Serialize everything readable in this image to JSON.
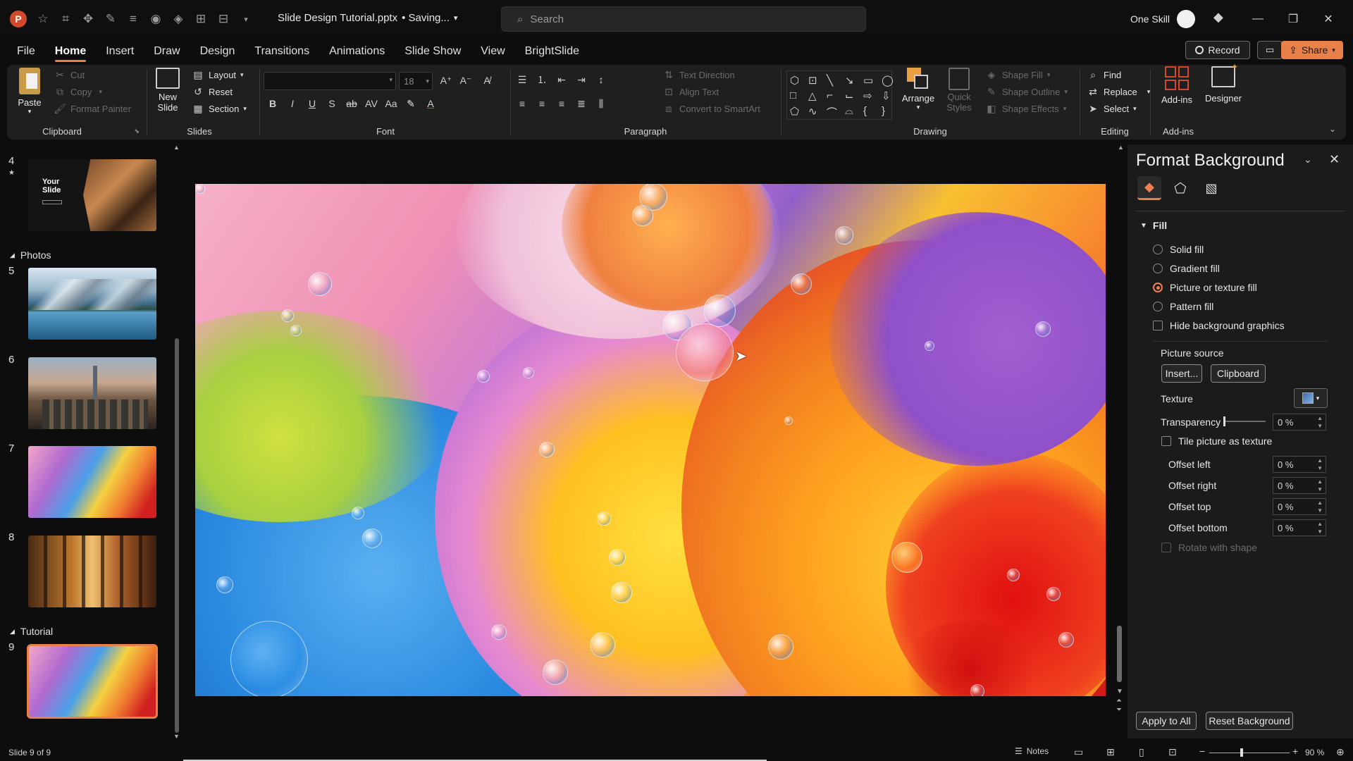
{
  "titlebar": {
    "file_name": "Slide Design Tutorial.pptx",
    "save_state": "• Saving...",
    "search_placeholder": "Search",
    "user_name": "One Skill"
  },
  "tabs": [
    "File",
    "Home",
    "Insert",
    "Draw",
    "Design",
    "Transitions",
    "Animations",
    "Slide Show",
    "View",
    "BrightSlide"
  ],
  "actions": {
    "record": "Record",
    "share": "Share"
  },
  "ribbon": {
    "clipboard": {
      "paste": "Paste",
      "cut": "Cut",
      "copy": "Copy",
      "format_painter": "Format Painter",
      "label": "Clipboard"
    },
    "slides": {
      "new_slide": "New Slide",
      "layout": "Layout",
      "reset": "Reset",
      "section": "Section",
      "label": "Slides"
    },
    "font": {
      "size": "18",
      "label": "Font"
    },
    "paragraph": {
      "text_direction": "Text Direction",
      "align_text": "Align Text",
      "smartart": "Convert to SmartArt",
      "label": "Paragraph"
    },
    "drawing": {
      "arrange": "Arrange",
      "quick_styles": "Quick Styles",
      "shape_fill": "Shape Fill",
      "shape_outline": "Shape Outline",
      "shape_effects": "Shape Effects",
      "label": "Drawing"
    },
    "editing": {
      "find": "Find",
      "replace": "Replace",
      "select": "Select",
      "label": "Editing"
    },
    "addins": {
      "addins": "Add-ins",
      "designer": "Designer",
      "label": "Add-ins"
    }
  },
  "thumbnails": {
    "slide4_title": "Your Slide",
    "sections": [
      {
        "name": "Photos"
      },
      {
        "name": "Tutorial"
      }
    ],
    "slides": [
      {
        "num": "4"
      },
      {
        "num": "5"
      },
      {
        "num": "6"
      },
      {
        "num": "7"
      },
      {
        "num": "8"
      },
      {
        "num": "9"
      }
    ]
  },
  "pane": {
    "title": "Format Background",
    "fill_header": "Fill",
    "options": {
      "solid": "Solid fill",
      "gradient": "Gradient fill",
      "picture": "Picture or texture fill",
      "pattern": "Pattern fill",
      "hide_graphics": "Hide background graphics"
    },
    "selected_fill": "Picture or texture fill",
    "picture_source": "Picture source",
    "insert": "Insert...",
    "clipboard": "Clipboard",
    "texture": "Texture",
    "transparency": "Transparency",
    "transparency_value": "0 %",
    "tile": "Tile picture as texture",
    "offset_left": "Offset left",
    "offset_left_value": "0 %",
    "offset_right": "Offset right",
    "offset_right_value": "0 %",
    "offset_top": "Offset top",
    "offset_top_value": "0 %",
    "offset_bottom": "Offset bottom",
    "offset_bottom_value": "0 %",
    "rotate": "Rotate with shape",
    "apply_all": "Apply to All",
    "reset_bg": "Reset Background"
  },
  "status": {
    "slide_info": "Slide 9 of 9",
    "notes": "Notes",
    "zoom": "90 %"
  },
  "colors": {
    "accent": "#e8804a",
    "share_bg": "#e8804a"
  }
}
